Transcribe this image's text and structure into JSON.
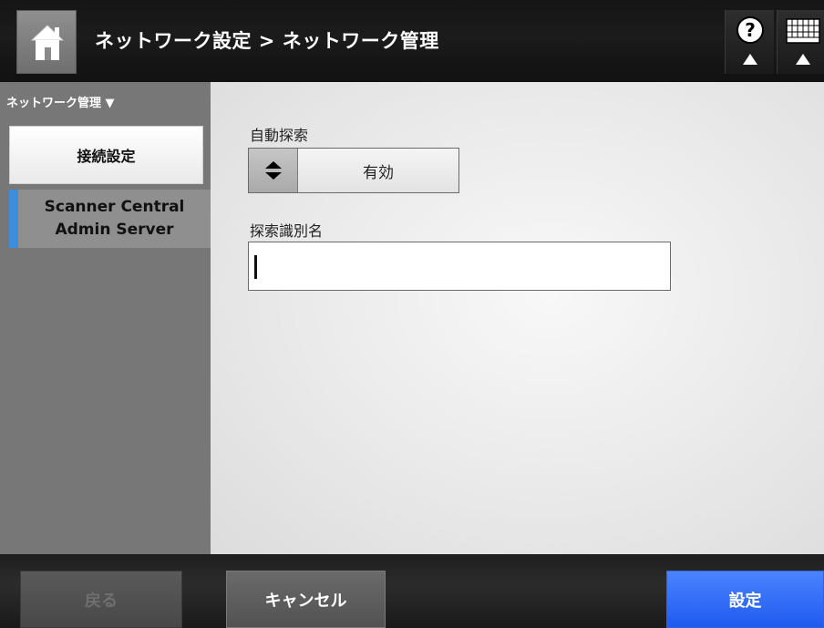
{
  "header": {
    "title": "ネットワーク設定 > ネットワーク管理",
    "home_icon": "home-icon",
    "help_icon": "help-icon",
    "keyboard_icon": "keyboard-icon"
  },
  "sidebar": {
    "heading": "ネットワーク管理 ▼",
    "items": [
      {
        "label": "接続設定"
      },
      {
        "label_line1": "Scanner Central",
        "label_line2": "Admin Server",
        "accent": "#3c8edc"
      }
    ]
  },
  "main": {
    "auto_discovery": {
      "label": "自動探索",
      "value": "有効"
    },
    "discovery_name": {
      "label": "探索識別名",
      "value": ""
    }
  },
  "footer": {
    "back_label": "戻る",
    "cancel_label": "キャンセル",
    "apply_label": "設定",
    "apply_color": "#2a63f5"
  }
}
